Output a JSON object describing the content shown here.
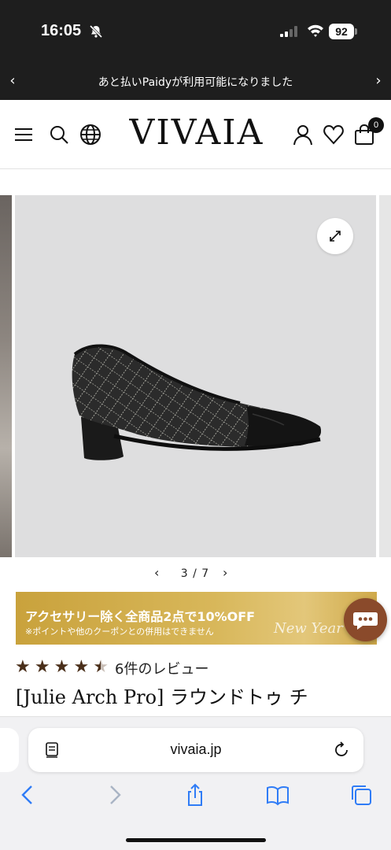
{
  "status_bar": {
    "time": "16:05",
    "battery": "92"
  },
  "announcement": {
    "text": "あと払いPaidyが利用可能になりました",
    "prev": "‹",
    "next": "›"
  },
  "header": {
    "logo": "VIVAIA",
    "cart_count": "0"
  },
  "gallery": {
    "pager": "3 / 7",
    "prev": "‹",
    "next": "›"
  },
  "promo": {
    "main": "アクセサリー除く全商品2点で10%OFF",
    "sub": "※ポイントや他のクーポンとの併用はできません",
    "script": "New Year"
  },
  "product": {
    "rating": 4.5,
    "stars": [
      "★",
      "★",
      "★",
      "★",
      "★"
    ],
    "review_text": "6件のレビュー",
    "title": "[Julie Arch Pro] ラウンドトゥ チ"
  },
  "browser": {
    "url": "vivaia.jp"
  },
  "icons": {
    "menu": "menu-icon",
    "search": "search-icon",
    "globe": "globe-icon",
    "account": "account-icon",
    "wishlist": "heart-icon",
    "cart": "cart-icon",
    "expand": "expand-icon",
    "chat": "chat-icon",
    "back": "back-icon",
    "forward": "forward-icon",
    "share": "share-icon",
    "bookmarks": "bookmarks-icon",
    "tabs": "tabs-icon",
    "reader": "reader-icon",
    "reload": "reload-icon"
  },
  "colors": {
    "accent_gold": "#d4b053",
    "chat_brown": "#8a4a2b",
    "ios_blue": "#2f7cf6"
  }
}
